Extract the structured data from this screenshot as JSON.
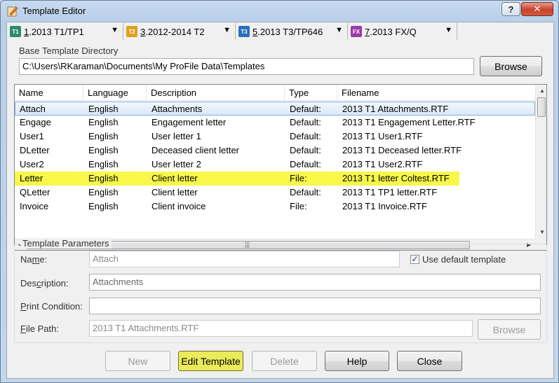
{
  "window": {
    "title": "Template Editor",
    "help_label": "?",
    "close_label": "✕"
  },
  "tabs": [
    {
      "icon_text": "T1",
      "icon_color": "#2d8a6e",
      "label_ul": "1",
      "label": ".2013 T1/TP1",
      "arrow": "▼"
    },
    {
      "icon_text": "T2",
      "icon_color": "#e0a020",
      "label_ul": "3",
      "label": ".2012-2014 T2",
      "arrow": "▼"
    },
    {
      "icon_text": "T3",
      "icon_color": "#2a6fbf",
      "label_ul": "5",
      "label": ".2013 T3/TP646",
      "arrow": "▼"
    },
    {
      "icon_text": "FX",
      "icon_color": "#9b3aa8",
      "label_ul": "7",
      "label": ".2013 FX/Q",
      "arrow": "▼"
    }
  ],
  "base_dir": {
    "label": "Base Template Directory",
    "value": "C:\\Users\\RKaraman\\Documents\\My ProFile Data\\Templates",
    "browse_label": "Browse"
  },
  "list": {
    "columns": [
      "Name",
      "Language",
      "Description",
      "Type",
      "Filename"
    ],
    "rows": [
      {
        "name": "Attach",
        "language": "English",
        "description": "Attachments",
        "type": "Default:",
        "filename": "2013 T1 Attachments.RTF",
        "state": "selected"
      },
      {
        "name": "Engage",
        "language": "English",
        "description": "Engagement letter",
        "type": "Default:",
        "filename": "2013 T1 Engagement Letter.RTF",
        "state": ""
      },
      {
        "name": "User1",
        "language": "English",
        "description": "User letter 1",
        "type": "Default:",
        "filename": "2013 T1 User1.RTF",
        "state": ""
      },
      {
        "name": "DLetter",
        "language": "English",
        "description": "Deceased client letter",
        "type": "Default:",
        "filename": "2013 T1 Deceased letter.RTF",
        "state": ""
      },
      {
        "name": "User2",
        "language": "English",
        "description": "User letter 2",
        "type": "Default:",
        "filename": "2013 T1 User2.RTF",
        "state": ""
      },
      {
        "name": "Letter",
        "language": "English",
        "description": "Client letter",
        "type": "File:",
        "filename": "2013 T1 letter Coltest.RTF",
        "state": "highlighted"
      },
      {
        "name": "QLetter",
        "language": "English",
        "description": "Client letter",
        "type": "Default:",
        "filename": "2013 T1 TP1 letter.RTF",
        "state": ""
      },
      {
        "name": "Invoice",
        "language": "English",
        "description": "Client invoice",
        "type": "File:",
        "filename": "2013 T1 Invoice.RTF",
        "state": ""
      }
    ],
    "highlight_color": "#f8f84a"
  },
  "params": {
    "group_label": "Template Parameters",
    "name_label_pre": "Na",
    "name_label_ul": "m",
    "name_label_post": "e:",
    "name_value": "Attach",
    "use_default_label": "Use default template",
    "use_default_checked": "✓",
    "desc_label_pre": "Des",
    "desc_label_ul": "c",
    "desc_label_post": "ription:",
    "desc_value": "Attachments",
    "print_label_pre": "",
    "print_label_ul": "P",
    "print_label_post": "rint Condition:",
    "print_value": "",
    "path_label_pre": "",
    "path_label_ul": "F",
    "path_label_post": "ile Path:",
    "path_value": "2013 T1 Attachments.RTF",
    "path_browse_label": "Browse"
  },
  "buttons": {
    "new": "New",
    "edit_template": "Edit Template",
    "delete": "Delete",
    "help": "Help",
    "close": "Close"
  }
}
